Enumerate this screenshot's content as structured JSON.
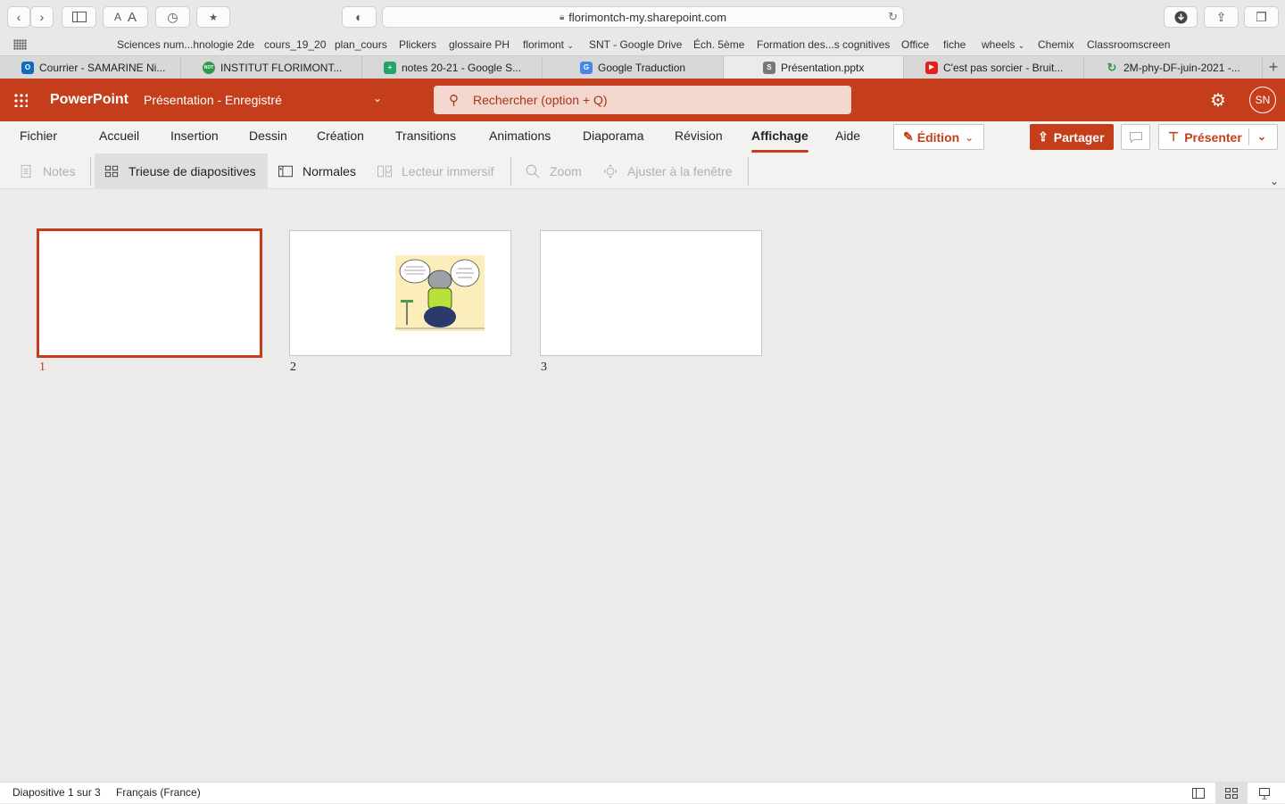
{
  "browser": {
    "url": "florimontch-my.sharepoint.com",
    "bookmarks": [
      "Sciences num...hnologie 2de",
      "cours_19_20",
      "plan_cours",
      "Plickers",
      "glossaire PH",
      "florimont",
      "SNT - Google Drive",
      "Éch. 5ème",
      "Formation des...s cognitives",
      "Office",
      "fiche",
      "wheels",
      "Chemix",
      "Classroomscreen"
    ],
    "tabs": [
      {
        "title": "Courrier - SAMARINE Ni...",
        "favicon": "outlook-icon",
        "color": "#0f6cbd",
        "letter": "O"
      },
      {
        "title": "INSTITUT FLORIMONT...",
        "favicon": "florimont-icon",
        "color": "#2e9b4a",
        "letter": "NOT"
      },
      {
        "title": "notes 20-21 - Google S...",
        "favicon": "google-sheets-icon",
        "color": "#23a566",
        "letter": "+"
      },
      {
        "title": "Google Traduction",
        "favicon": "google-translate-icon",
        "color": "#4a86e8",
        "letter": "G"
      },
      {
        "title": "Présentation.pptx",
        "favicon": "sharepoint-icon",
        "color": "#777777",
        "letter": "S"
      },
      {
        "title": "C'est pas sorcier - Bruit...",
        "favicon": "youtube-icon",
        "color": "#e62117",
        "letter": "▶"
      },
      {
        "title": "2M-phy-DF-juin-2021 -...",
        "favicon": "refresh-leaf-icon",
        "color": "#2e9b4a",
        "letter": "↻"
      }
    ]
  },
  "app": {
    "name": "PowerPoint",
    "doc_title": "Présentation  -  Enregistré",
    "search_placeholder": "Rechercher (option + Q)",
    "avatar": "SN",
    "accent": "#c43e1c"
  },
  "ribbon": {
    "tabs": [
      "Fichier",
      "Accueil",
      "Insertion",
      "Dessin",
      "Création",
      "Transitions",
      "Animations",
      "Diaporama",
      "Révision",
      "Affichage",
      "Aide"
    ],
    "active_tab": "Affichage",
    "edit_mode": "Édition",
    "share": "Partager",
    "present": "Présenter",
    "commands": {
      "notes": "Notes",
      "sorter": "Trieuse de diapositives",
      "normal": "Normales",
      "reader": "Lecteur immersif",
      "zoom": "Zoom",
      "fit": "Ajuster à la fenêtre"
    }
  },
  "slides": [
    {
      "number": "1",
      "selected": true
    },
    {
      "number": "2",
      "selected": false
    },
    {
      "number": "3",
      "selected": false
    }
  ],
  "status": {
    "slide_info": "Diapositive 1 sur 3",
    "language": "Français (France)"
  }
}
